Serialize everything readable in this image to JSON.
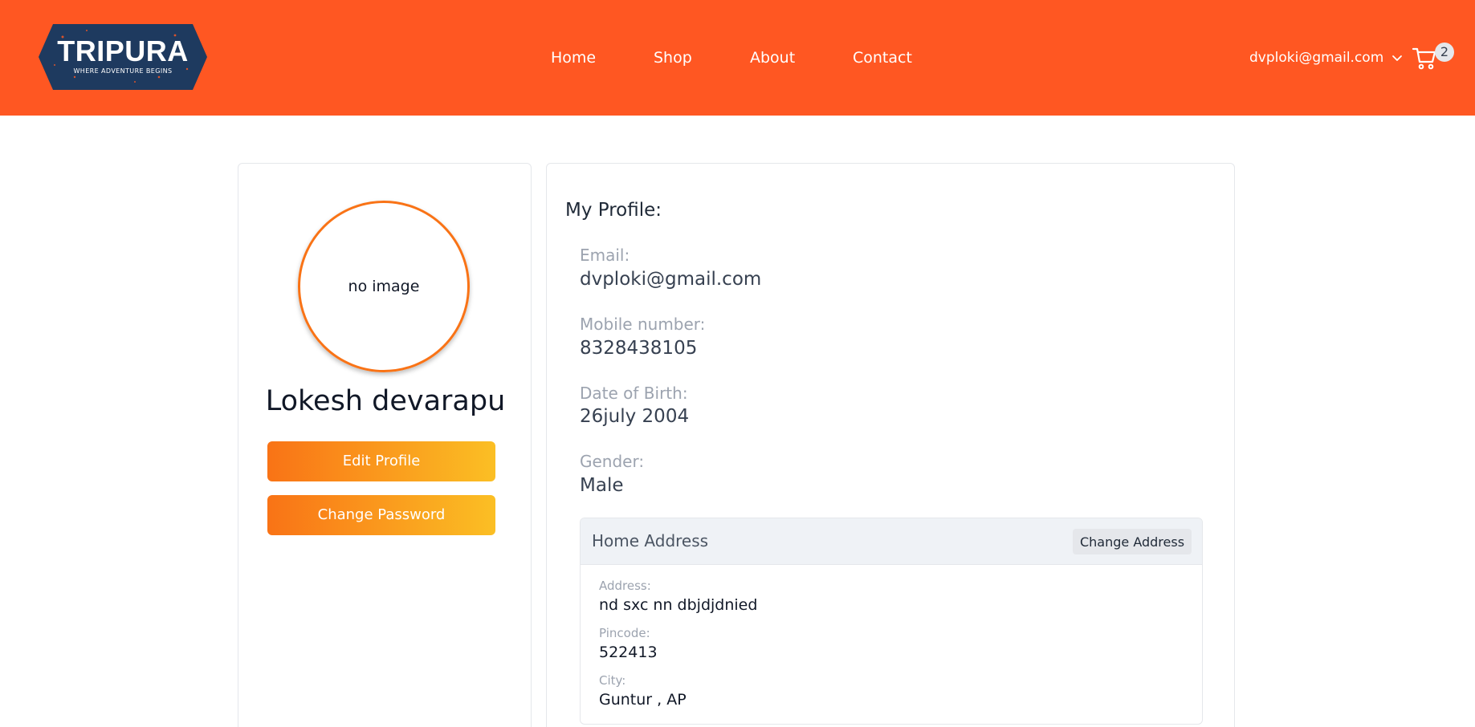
{
  "brand": {
    "title": "TRIPURA",
    "tagline": "WHERE ADVENTURE BEGINS"
  },
  "nav": {
    "items": [
      "Home",
      "Shop",
      "About",
      "Contact"
    ]
  },
  "user_menu": {
    "email": "dvploki@gmail.com",
    "icon": "chevron-down-icon"
  },
  "cart": {
    "icon": "cart-icon",
    "count": "2"
  },
  "profile_card": {
    "avatar_text": "no image",
    "name": "Lokesh devarapu",
    "edit_label": "Edit Profile",
    "password_label": "Change Password"
  },
  "details": {
    "heading": "My Profile:",
    "email_label": "Email:",
    "email_value": "dvploki@gmail.com",
    "mobile_label": "Mobile number:",
    "mobile_value": "8328438105",
    "dob_label": "Date of Birth:",
    "dob_value": "26july 2004",
    "gender_label": "Gender:",
    "gender_value": "Male"
  },
  "address": {
    "title": "Home Address",
    "change_label": "Change Address",
    "address_label": "Address:",
    "address_value": "nd sxc nn dbjdjdnied",
    "pincode_label": "Pincode:",
    "pincode_value": "522413",
    "city_label": "City:",
    "city_value": "Guntur , AP"
  },
  "colors": {
    "header": "#ff5722",
    "logo_bg": "#1e3a5f",
    "button_gradient_start": "#f97316",
    "button_gradient_end": "#fbbf24",
    "avatar_border": "#f97316"
  }
}
